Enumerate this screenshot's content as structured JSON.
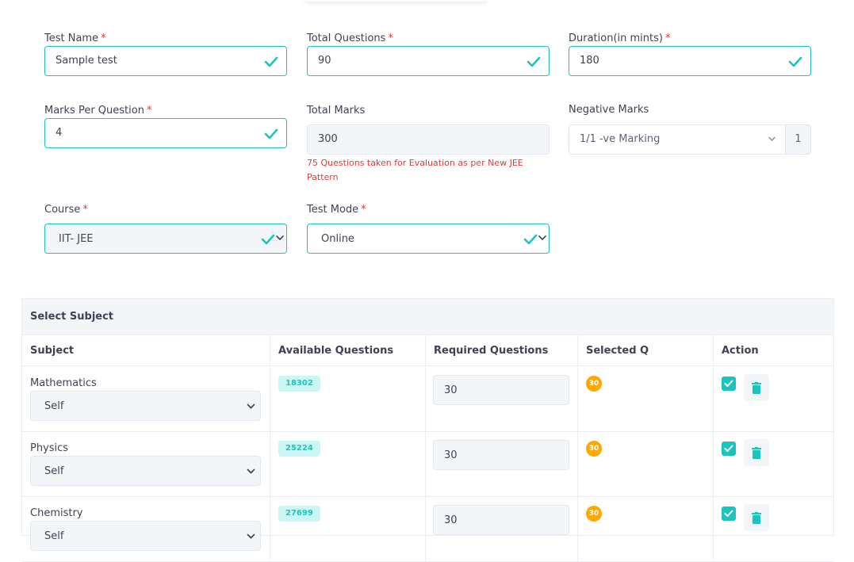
{
  "form": {
    "test_name": {
      "label": "Test Name",
      "required": "*",
      "value": "Sample test"
    },
    "total_questions": {
      "label": "Total Questions",
      "required": "*",
      "value": "90"
    },
    "duration": {
      "label": "Duration(in mints)",
      "required": "*",
      "value": "180"
    },
    "marks_per_question": {
      "label": "Marks Per Question",
      "required": "*",
      "value": "4"
    },
    "total_marks": {
      "label": "Total Marks",
      "value": "300",
      "note": "75 Questions taken for Evaluation as per New JEE Pattern"
    },
    "negative_marks": {
      "label": "Negative Marks",
      "selected": "1/1 -ve Marking",
      "addon": "1"
    },
    "course": {
      "label": "Course",
      "required": "*",
      "selected": "IIT- JEE"
    },
    "test_mode": {
      "label": "Test Mode",
      "required": "*",
      "selected": "Online"
    }
  },
  "subjects_card": {
    "title": "Select Subject",
    "columns": [
      "Subject",
      "Available Questions",
      "Required Questions",
      "Selected Q",
      "Action"
    ],
    "rows": [
      {
        "subject": "Mathematics",
        "source": "Self",
        "available": "18302",
        "required": "30",
        "selected": "30"
      },
      {
        "subject": "Physics",
        "source": "Self",
        "available": "25224",
        "required": "30",
        "selected": "30"
      },
      {
        "subject": "Chemistry",
        "source": "Self",
        "available": "27699",
        "required": "30",
        "selected": "30"
      }
    ]
  },
  "colors": {
    "accent": "#1bc5bd",
    "danger": "#e53935",
    "warning": "#ffa800",
    "input_bg": "#f3f6f9"
  },
  "icons": {
    "valid": "check-icon",
    "dropdown": "chevron-down-icon",
    "checkbox": "checkbox-checked-icon",
    "delete": "trash-icon"
  }
}
